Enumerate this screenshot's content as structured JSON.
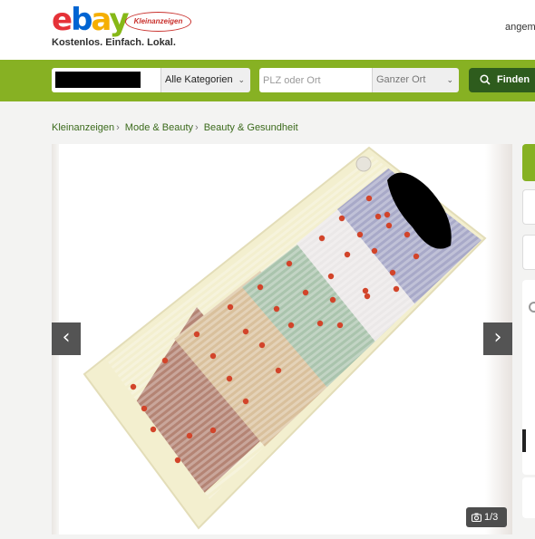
{
  "header": {
    "logo_text": [
      "e",
      "b",
      "a",
      "y"
    ],
    "logo_badge": "Kleinanzeigen",
    "tagline": "Kostenlos. Einfach. Lokal.",
    "user_link": "angem"
  },
  "search": {
    "category_label": "Alle Kategorien",
    "location_placeholder": "PLZ oder Ort",
    "radius_label": "Ganzer Ort",
    "find_label": "Finden"
  },
  "breadcrumb": {
    "items": [
      "Kleinanzeigen",
      "Mode & Beauty",
      "Beauty & Gesundheit"
    ]
  },
  "gallery": {
    "counter": "1/3",
    "prev_icon": "chevron-left-icon",
    "next_icon": "chevron-right-icon",
    "image_subject": "heating-mat-photo"
  },
  "colors": {
    "brand_green": "#86b123",
    "dark_green": "#2e5c1d",
    "link_green": "#3b6a1c"
  }
}
